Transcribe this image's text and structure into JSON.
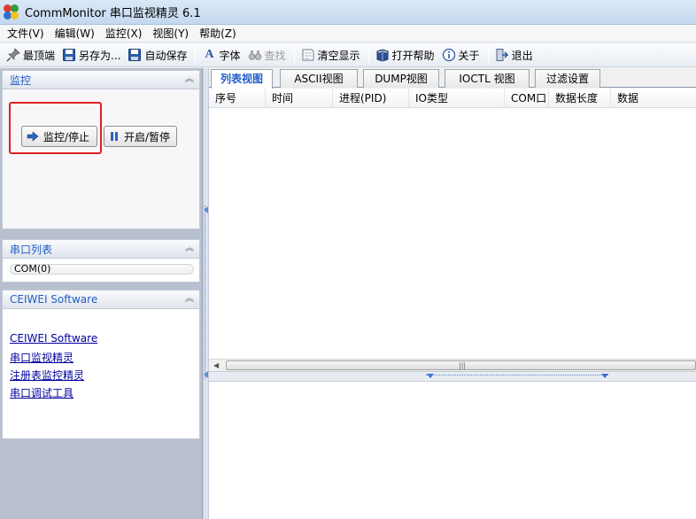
{
  "window": {
    "title": "CommMonitor 串口监视精灵 6.1"
  },
  "menu": [
    {
      "label": "文件(V)"
    },
    {
      "label": "编辑(W)"
    },
    {
      "label": "监控(X)"
    },
    {
      "label": "视图(Y)"
    },
    {
      "label": "帮助(Z)"
    }
  ],
  "toolbar": {
    "topmost": "最顶端",
    "save_as": "另存为...",
    "auto_save": "自动保存",
    "font": "字体",
    "find": "查找",
    "clear": "清空显示",
    "open_help": "打开帮助",
    "about": "关于",
    "exit": "退出"
  },
  "left": {
    "monitor": {
      "title": "监控",
      "monitor_stop": "监控/停止",
      "start_pause": "开启/暂停"
    },
    "ports": {
      "title": "串口列表",
      "items": [
        "COM(0)"
      ]
    },
    "software": {
      "title": "CEIWEI Software",
      "links": [
        "CEIWEI Software",
        "串口监视精灵",
        "注册表监控精灵",
        "串口调试工具"
      ]
    }
  },
  "tabs": [
    "列表视图",
    "ASCII视图",
    "DUMP视图",
    "IOCTL 视图",
    "过滤设置"
  ],
  "grid": {
    "columns": [
      "序号",
      "时间",
      "进程(PID)",
      "IO类型",
      "COM口",
      "数据长度",
      "数据"
    ]
  },
  "colors": {
    "accent": "#215dc6",
    "highlight": "#e02020",
    "panel_bg": "#b8c0d0"
  }
}
